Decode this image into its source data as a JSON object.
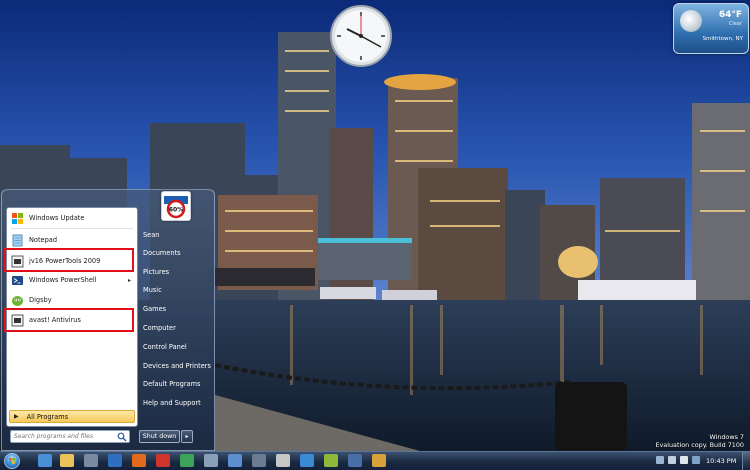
{
  "gadgets": {
    "weather": {
      "temp": "64°F",
      "condition": "Clear",
      "location": "Smithtown, NY"
    }
  },
  "start_menu": {
    "programs": [
      {
        "label": "Windows Update",
        "icon": "windows-update-icon"
      },
      {
        "label": "Notepad",
        "icon": "notepad-icon"
      },
      {
        "label": "jv16 PowerTools 2009",
        "icon": "jv16-icon"
      },
      {
        "label": "Windows PowerShell",
        "icon": "powershell-icon",
        "has_submenu": true
      },
      {
        "label": "Digsby",
        "icon": "digsby-icon"
      },
      {
        "label": "avast! Antivirus",
        "icon": "avast-icon"
      }
    ],
    "all_programs_label": "All Programs",
    "search_placeholder": "Search programs and files",
    "user_picture_text": "60%",
    "right_items": [
      "Sean",
      "Documents",
      "Pictures",
      "Music",
      "Games",
      "Computer",
      "Control Panel",
      "Devices and Printers",
      "Default Programs",
      "Help and Support"
    ],
    "shutdown_label": "Shut down",
    "shutdown_arrow": "▸",
    "submenu_arrow": "▸",
    "all_programs_arrow": "▶"
  },
  "watermark": {
    "line1": "Windows 7",
    "line2": "Evaluation copy. Build 7100"
  },
  "taskbar": {
    "clock": "10:43 PM",
    "colors": {
      "highlight": "#e0101a"
    }
  }
}
